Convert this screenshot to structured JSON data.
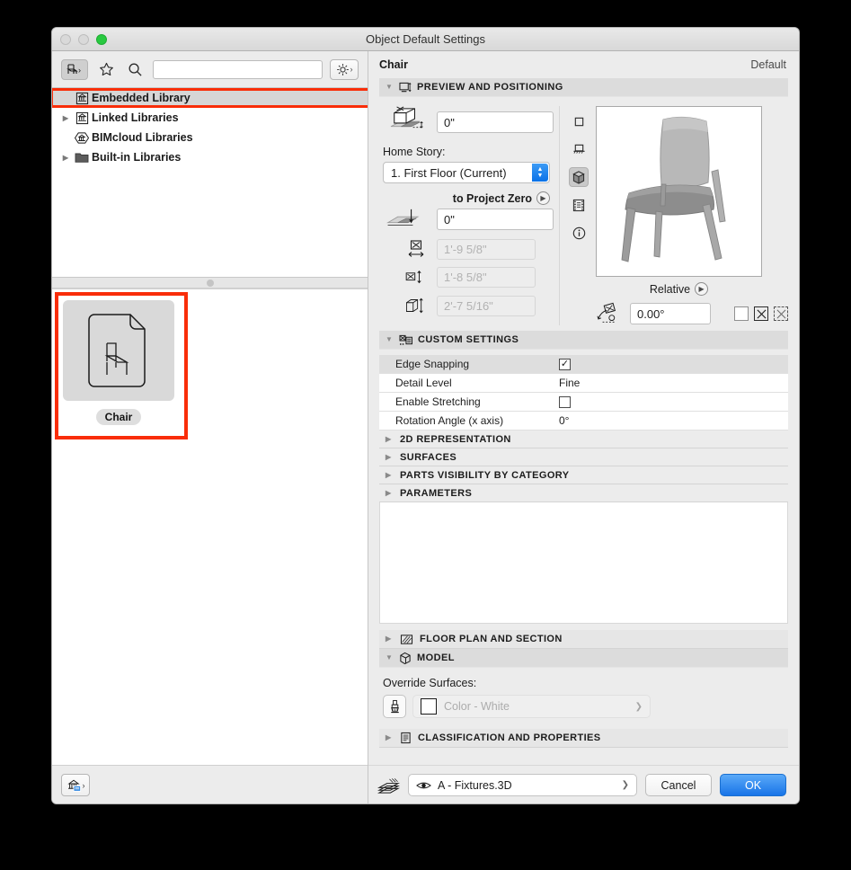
{
  "window": {
    "title": "Object Default Settings",
    "traffic_lights": [
      "close-disabled",
      "minimize-disabled",
      "zoom-green"
    ]
  },
  "library_panel": {
    "toolbar": {
      "object_tool_icon": "chair-object-icon",
      "favorites_icon": "star-icon",
      "search_icon": "search-icon",
      "search_value": "",
      "search_placeholder": "",
      "settings_icon": "gear-icon"
    },
    "tree": [
      {
        "label": "Embedded Library",
        "icon": "library-bank-icon",
        "selected": true,
        "expandable": false,
        "highlighted": true
      },
      {
        "label": "Linked Libraries",
        "icon": "library-bank-icon",
        "selected": false,
        "expandable": true,
        "highlighted": false
      },
      {
        "label": "BIMcloud Libraries",
        "icon": "bimcloud-bank-icon",
        "selected": false,
        "expandable": false,
        "highlighted": false
      },
      {
        "label": "Built-in Libraries",
        "icon": "folder-icon",
        "selected": false,
        "expandable": true,
        "highlighted": false
      }
    ],
    "items": [
      {
        "label": "Chair",
        "thumbnail_icon": "chair-document-icon",
        "highlighted": true
      }
    ],
    "manage_libraries_icon": "library-manager-icon"
  },
  "settings_panel": {
    "object_name": "Chair",
    "default_label": "Default",
    "sections": {
      "preview_and_positioning": {
        "title": "PREVIEW AND POSITIONING",
        "icon": "preview-positioning-icon",
        "expanded": true,
        "elevation_to_story_value": "0\"",
        "elevation_to_story_icon": "box-on-story-icon",
        "home_story_label": "Home Story:",
        "home_story_value": "1. First Floor (Current)",
        "to_project_zero_label": "to Project Zero",
        "elevation_to_zero_value": "0\"",
        "elevation_to_zero_icon": "slab-to-zero-icon",
        "width_value": "1'-9 5/8\"",
        "width_icon": "width-dimension-icon",
        "depth_value": "1'-8 5/8\"",
        "depth_icon": "depth-dimension-icon",
        "height_value": "2'-7 5/16\"",
        "height_icon": "height-dimension-icon",
        "view_buttons": [
          {
            "icon": "top-view-icon",
            "selected": false
          },
          {
            "icon": "front-elevation-icon",
            "selected": false
          },
          {
            "icon": "3d-view-icon",
            "selected": true
          },
          {
            "icon": "animation-filmstrip-icon",
            "selected": false
          },
          {
            "icon": "info-icon",
            "selected": false
          }
        ],
        "preview_image": "chair-3d-render",
        "relative_label": "Relative",
        "mirror_icon": "mirror-rotate-icon",
        "rotation_value": "0.00°",
        "toggle_icons": [
          "empty-checkbox",
          "mirrored-solid-icon",
          "mirrored-dashed-icon"
        ]
      },
      "custom_settings": {
        "title": "CUSTOM SETTINGS",
        "icon": "custom-settings-icon",
        "expanded": true,
        "rows": [
          {
            "name": "Edge Snapping",
            "value": "",
            "control": "checkbox",
            "checked": true
          },
          {
            "name": "Detail Level",
            "value": "Fine",
            "control": "text",
            "checked": false
          },
          {
            "name": "Enable Stretching",
            "value": "",
            "control": "checkbox",
            "checked": false
          },
          {
            "name": "Rotation Angle (x axis)",
            "value": "0°",
            "control": "text",
            "checked": false
          }
        ],
        "subsections": [
          "2D REPRESENTATION",
          "SURFACES",
          "PARTS VISIBILITY BY CATEGORY",
          "PARAMETERS"
        ]
      },
      "floor_plan_and_section": {
        "title": "FLOOR PLAN AND SECTION",
        "icon": "floor-plan-section-icon",
        "expanded": false
      },
      "model": {
        "title": "MODEL",
        "icon": "model-cube-icon",
        "expanded": true,
        "override_surfaces_label": "Override Surfaces:",
        "brush_icon": "paint-brush-icon",
        "surface_name": "Color - White",
        "surface_swatch_color": "#ffffff"
      },
      "classification_and_properties": {
        "title": "CLASSIFICATION AND PROPERTIES",
        "icon": "classification-list-icon",
        "expanded": false
      }
    },
    "footer": {
      "layers_icon": "layers-stack-icon",
      "layer_eye_icon": "eye-icon",
      "layer_value": "A - Fixtures.3D",
      "cancel_label": "Cancel",
      "ok_label": "OK"
    }
  },
  "colors": {
    "highlight_red": "#f92d09",
    "accent_blue": "#1874e8",
    "window_bg": "#ececec",
    "section_header_bg": "#dcdcdc"
  }
}
